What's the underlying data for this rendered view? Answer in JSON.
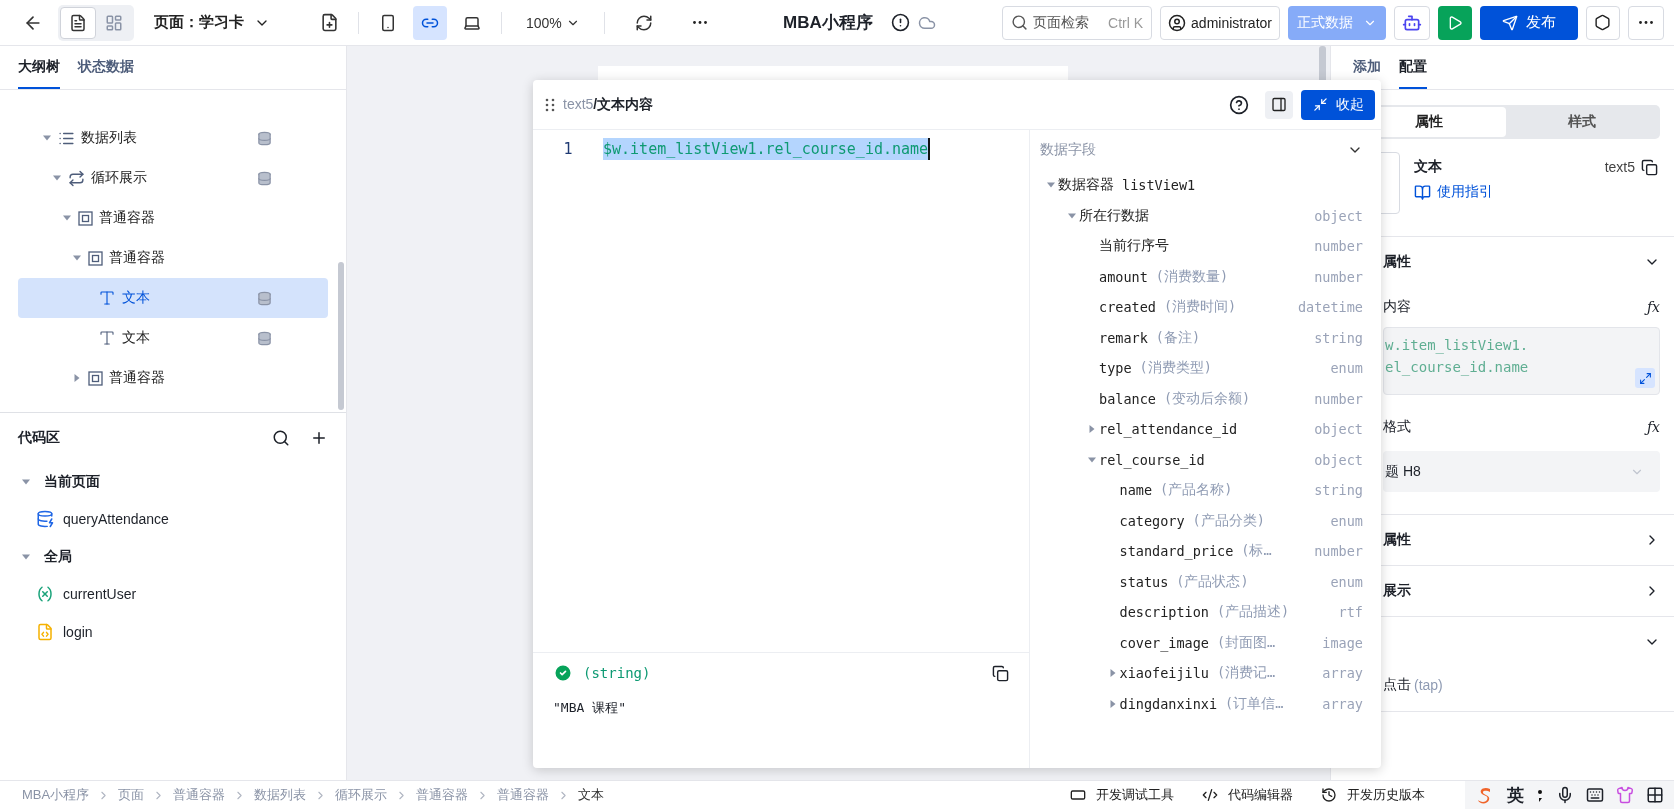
{
  "topbar": {
    "view_modes": [
      {
        "kind": "page",
        "selected": true
      },
      {
        "kind": "layout",
        "selected": false
      }
    ],
    "page_label": "页面：学习卡",
    "devices": [
      {
        "kind": "mobile",
        "selected": false
      },
      {
        "kind": "miniprogram",
        "selected": true
      },
      {
        "kind": "desktop",
        "selected": false
      }
    ],
    "zoom": "100%",
    "app_title": "MBA小程序",
    "search": {
      "placeholder": "页面检索",
      "shortcut": "Ctrl K"
    },
    "user": "administrator",
    "env": "正式数据",
    "publish": "发布"
  },
  "left_tabs": [
    {
      "label": "大纲树",
      "selected": true
    },
    {
      "label": "状态数据",
      "selected": false
    }
  ],
  "outline": [
    {
      "label": "数据列表",
      "kind": "list",
      "expanded": true,
      "selected": false,
      "bound": true,
      "children": [
        {
          "label": "循环展示",
          "kind": "loop",
          "expanded": true,
          "selected": false,
          "bound": true,
          "children": [
            {
              "label": "普通容器",
              "kind": "container",
              "expanded": true,
              "selected": false,
              "bound": false,
              "children": [
                {
                  "label": "普通容器",
                  "kind": "container",
                  "expanded": true,
                  "selected": false,
                  "bound": false,
                  "children": [
                    {
                      "label": "文本",
                      "kind": "text",
                      "selected": true,
                      "bound": true
                    },
                    {
                      "label": "文本",
                      "kind": "text",
                      "selected": false,
                      "bound": true
                    }
                  ]
                },
                {
                  "label": "普通容器",
                  "kind": "container",
                  "expanded": false,
                  "selected": false,
                  "bound": false
                }
              ]
            }
          ]
        }
      ]
    }
  ],
  "code_area": {
    "title": "代码区",
    "groups": [
      {
        "label": "当前页面",
        "expanded": true,
        "items": [
          {
            "kind": "query",
            "name": "queryAttendance"
          }
        ]
      },
      {
        "label": "全局",
        "expanded": true,
        "items": [
          {
            "kind": "variable",
            "name": "currentUser"
          },
          {
            "kind": "script",
            "name": "login"
          }
        ]
      }
    ]
  },
  "editor": {
    "path_id": "text5",
    "path_title": "/文本内容",
    "collapse": "收起",
    "line_number": "1",
    "code": "$w.item_listView1.rel_course_id.name",
    "result_type": "(string)",
    "result_value": "\"MBA 课程\"",
    "fields_title": "数据字段",
    "fields": [
      {
        "name": "数据容器",
        "note": "listView1",
        "expanded": true,
        "children": [
          {
            "name": "所在行数据",
            "type": "object",
            "expanded": true,
            "children": [
              {
                "name": "当前行序号",
                "type": "number"
              },
              {
                "name": "amount",
                "note": "(消费数量)",
                "type": "number"
              },
              {
                "name": "created",
                "note": "(消费时间)",
                "type": "datetime"
              },
              {
                "name": "remark",
                "note": "(备注)",
                "type": "string"
              },
              {
                "name": "type",
                "note": "(消费类型)",
                "type": "enum"
              },
              {
                "name": "balance",
                "note": "(变动后余额)",
                "type": "number"
              },
              {
                "name": "rel_attendance_id",
                "type": "object",
                "expanded": false
              },
              {
                "name": "rel_course_id",
                "type": "object",
                "expanded": true,
                "children": [
                  {
                    "name": "name",
                    "note": "(产品名称)",
                    "type": "string"
                  },
                  {
                    "name": "category",
                    "note": "(产品分类)",
                    "type": "enum"
                  },
                  {
                    "name": "standard_price",
                    "note": "(标…",
                    "type": "number"
                  },
                  {
                    "name": "status",
                    "note": "(产品状态)",
                    "type": "enum"
                  },
                  {
                    "name": "description",
                    "note": "(产品描述)",
                    "type": "rtf"
                  },
                  {
                    "name": "cover_image",
                    "note": "(封面图…",
                    "type": "image"
                  },
                  {
                    "name": "xiaofeijilu",
                    "note": "(消费记…",
                    "type": "array",
                    "expanded": false
                  },
                  {
                    "name": "dingdanxinxi",
                    "note": "(订单信…",
                    "type": "array",
                    "expanded": false
                  }
                ]
              }
            ]
          }
        ]
      }
    ]
  },
  "right_panel": {
    "tabs": [
      {
        "label": "添加",
        "selected": false
      },
      {
        "label": "配置",
        "selected": true
      }
    ],
    "segments": [
      {
        "label": "属性",
        "selected": true
      },
      {
        "label": "样式",
        "selected": false
      }
    ],
    "component": {
      "name": "文本",
      "guide": "使用指引",
      "id": "text5"
    },
    "sections": [
      {
        "kind": "props",
        "title": "属性",
        "expanded": true,
        "content_label": "内容",
        "content_action": "ƒx",
        "content_lines": [
          "w.item_listView1.",
          "el_course_id.name"
        ],
        "format_label": "格式",
        "format_action": "ƒx",
        "format_value": "题 H8"
      },
      {
        "kind": "plain",
        "title": "属性",
        "expanded": false
      },
      {
        "kind": "plain",
        "title": "展示",
        "expanded": false
      },
      {
        "kind": "events",
        "expanded": true,
        "event": "点击",
        "event_code": "(tap)"
      }
    ]
  },
  "status_bar": {
    "breadcrumbs": [
      "MBA小程序",
      "页面",
      "普通容器",
      "数据列表",
      "循环展示",
      "普通容器",
      "普通容器",
      "文本"
    ],
    "tools": [
      {
        "kind": "debug",
        "label": "开发调试工具"
      },
      {
        "kind": "code",
        "label": "代码编辑器"
      },
      {
        "kind": "history",
        "label": "开发历史版本"
      }
    ],
    "ime_mode": "英"
  }
}
